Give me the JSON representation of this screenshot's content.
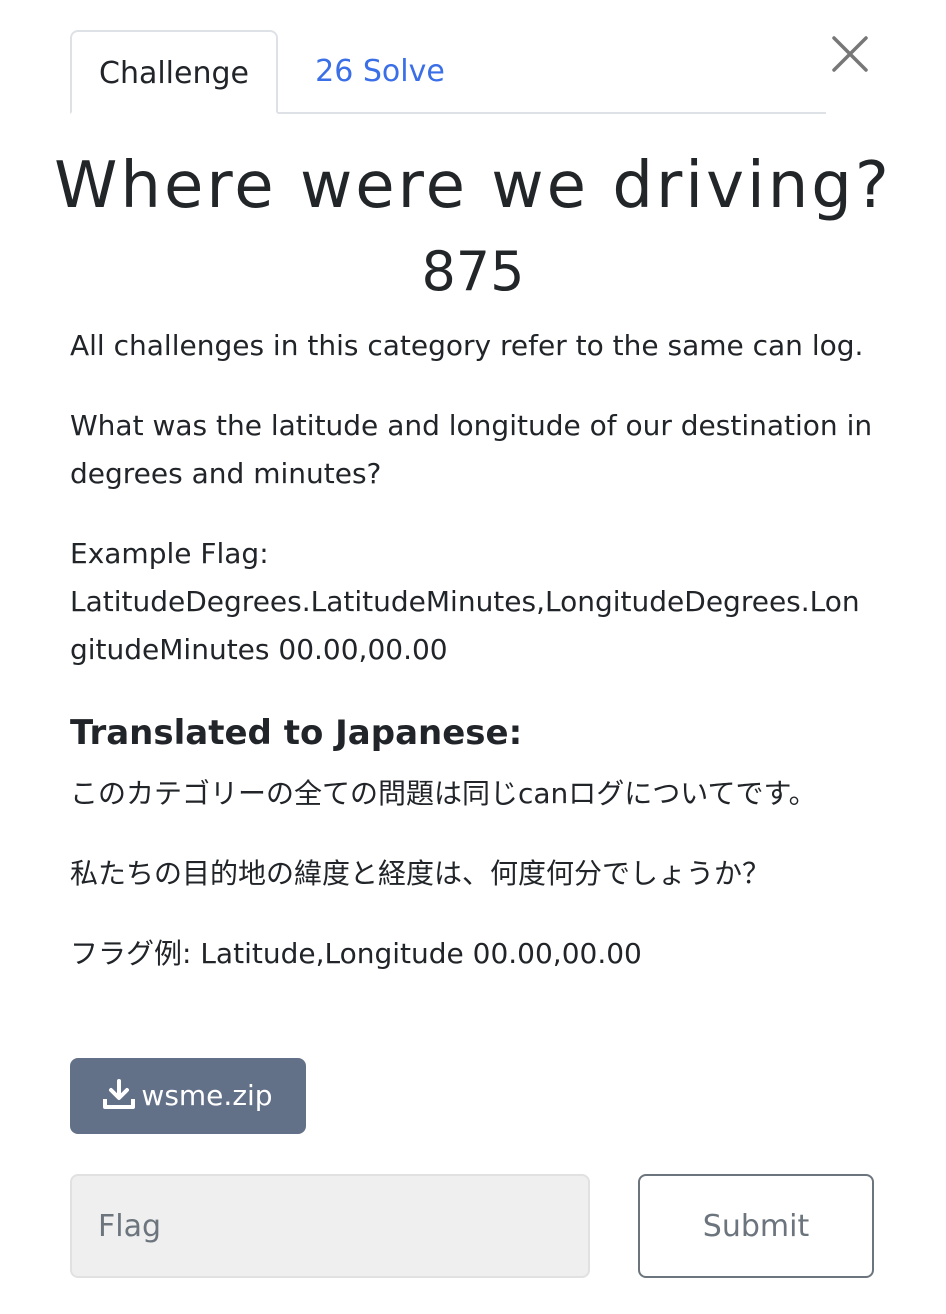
{
  "tabs": {
    "challenge": "Challenge",
    "solves": "26 Solve"
  },
  "challenge": {
    "name": "Where were we driving?",
    "value": "875"
  },
  "description": {
    "p1": "All challenges in this category refer to the same can log.",
    "p2": "What was the latitude and longitude of our destination in degrees and minutes?",
    "p3_label": "Example Flag:",
    "p3_body": "LatitudeDegrees.LatitudeMinutes,LongitudeDegrees.LongitudeMinutes 00.00,00.00",
    "heading": "Translated to Japanese:",
    "jp1": "このカテゴリーの全ての問題は同じcanログについてです。",
    "jp2": "私たちの目的地の緯度と経度は、何度何分でしょうか？",
    "jp3": "フラグ例: Latitude,Longitude 00.00,00.00"
  },
  "file": {
    "name": "wsme.zip"
  },
  "form": {
    "flag_placeholder": "Flag",
    "submit_label": "Submit"
  },
  "colors": {
    "tab_link": "#3a6fe8",
    "download_button": "#627088",
    "input_bg": "#efefef"
  },
  "icons": {
    "close": "close-icon",
    "download": "download-icon"
  }
}
